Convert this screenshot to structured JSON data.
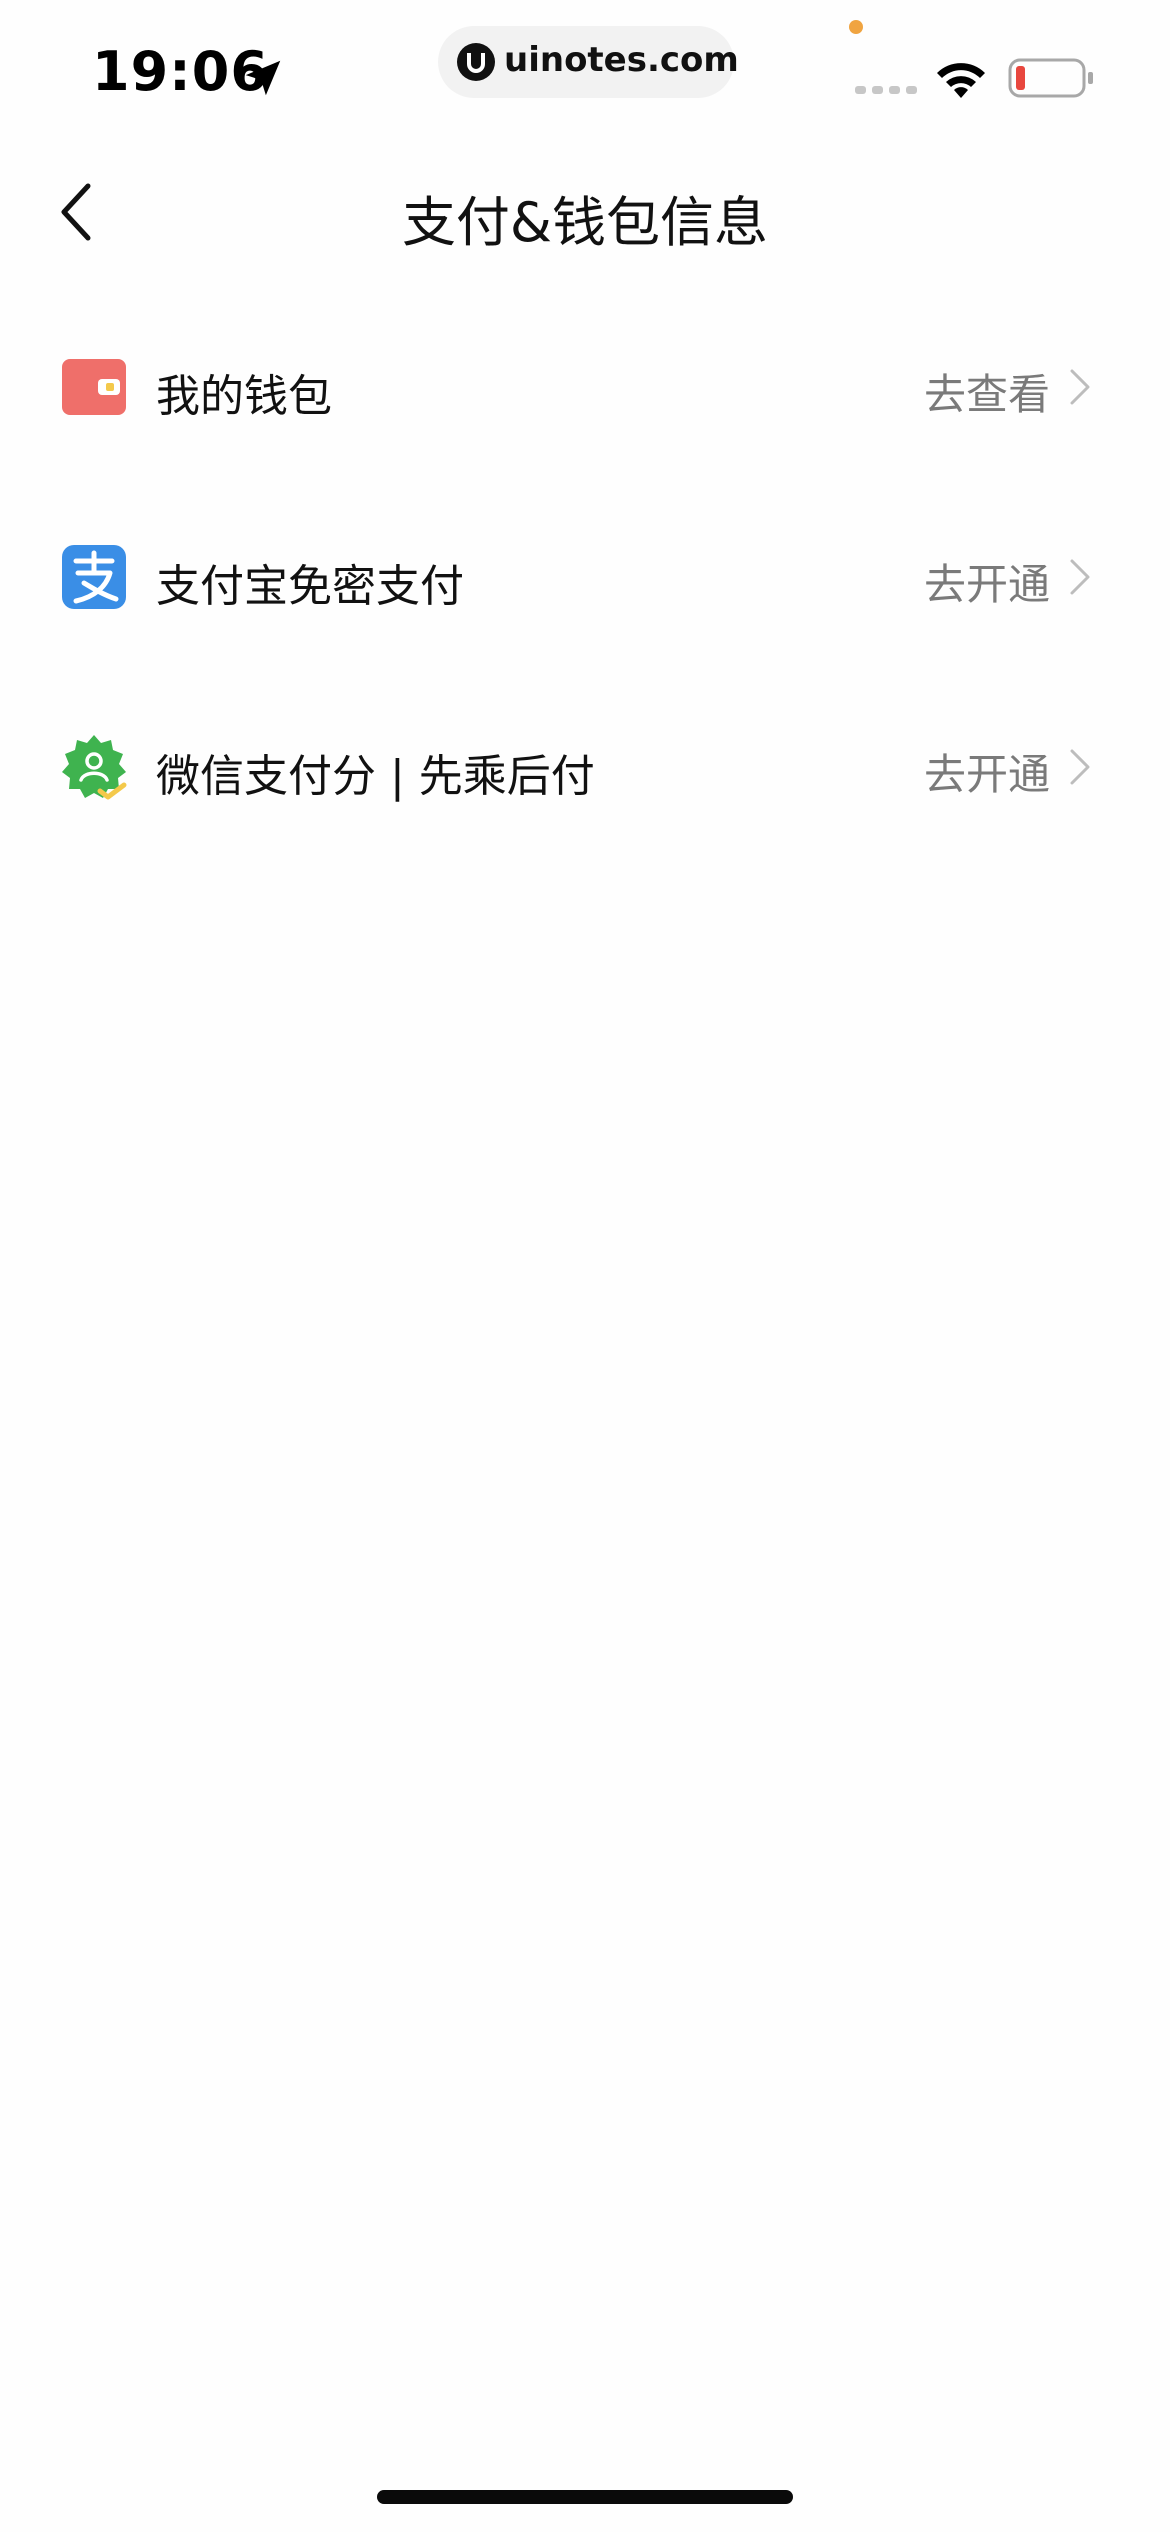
{
  "status_bar": {
    "time": "19:06",
    "url": "uinotes.com",
    "location_icon": "location-arrow-icon",
    "wifi_icon": "wifi-icon",
    "signal_icon": "cellular-signal-icon",
    "battery_icon": "battery-low-icon",
    "colors": {
      "battery_level": "#e8473e",
      "privacy_dot": "#f0a441"
    }
  },
  "nav": {
    "title": "支付&钱包信息",
    "back_icon": "chevron-left-icon"
  },
  "rows": [
    {
      "label": "我的钱包",
      "action": "去查看",
      "icon": "wallet-icon",
      "icon_color": "#ef6f6a"
    },
    {
      "label": "支付宝免密支付",
      "action": "去开通",
      "icon": "alipay-icon",
      "icon_color": "#3a8ee6"
    },
    {
      "label": "微信支付分 | 先乘后付",
      "action": "去开通",
      "icon": "wechat-pay-score-icon",
      "icon_color": "#3fb34f"
    }
  ],
  "chevron_icon": "chevron-right-icon"
}
